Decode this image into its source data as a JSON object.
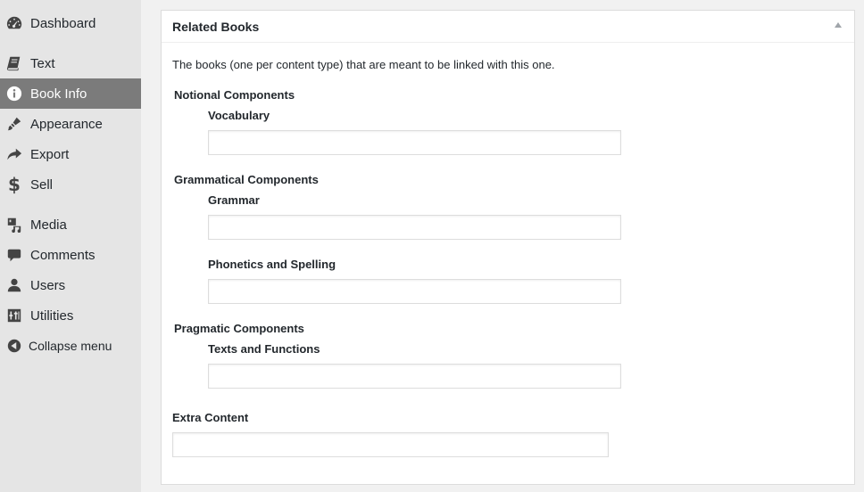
{
  "sidebar": {
    "items": [
      {
        "label": "Dashboard",
        "icon": "dashboard-icon"
      },
      {
        "label": "Text",
        "icon": "book-icon"
      },
      {
        "label": "Book Info",
        "icon": "info-icon",
        "active": true
      },
      {
        "label": "Appearance",
        "icon": "paintbrush-icon"
      },
      {
        "label": "Export",
        "icon": "export-arrow-icon"
      },
      {
        "label": "Sell",
        "icon": "dollar-icon"
      },
      {
        "label": "Media",
        "icon": "media-icon"
      },
      {
        "label": "Comments",
        "icon": "comment-icon"
      },
      {
        "label": "Users",
        "icon": "user-icon"
      },
      {
        "label": "Utilities",
        "icon": "utilities-icon"
      }
    ],
    "collapse_label": "Collapse menu"
  },
  "panel": {
    "title": "Related Books",
    "description": "The books (one per content type) that are meant to be linked with this one.",
    "groups": [
      {
        "label": "Notional Components",
        "fields": [
          {
            "label": "Vocabulary",
            "value": ""
          }
        ]
      },
      {
        "label": "Grammatical Components",
        "fields": [
          {
            "label": "Grammar",
            "value": ""
          },
          {
            "label": "Phonetics and Spelling",
            "value": ""
          }
        ]
      },
      {
        "label": "Pragmatic Components",
        "fields": [
          {
            "label": "Texts and Functions",
            "value": ""
          }
        ]
      }
    ],
    "extra": {
      "label": "Extra Content",
      "value": ""
    }
  },
  "colors": {
    "sidebar_bg": "#e5e5e5",
    "active_item_bg": "#7b7b7b",
    "page_bg": "#f1f1f1"
  }
}
